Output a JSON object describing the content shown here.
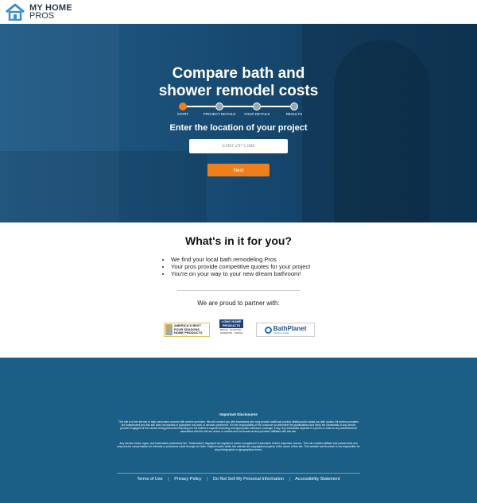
{
  "brand": {
    "line1": "MY HOME",
    "line2": "PROS",
    "accent": "#f07e1a",
    "footer_color": "#1b5f86"
  },
  "hero": {
    "title_line1": "Compare bath and",
    "title_line2": "shower remodel costs",
    "steps": [
      "START",
      "PROJECT DETAILS",
      "YOUR DETAILS",
      "RESULTS"
    ],
    "active_step_index": 0,
    "subtitle": "Enter the location of your project",
    "zip_placeholder": "Enter ZIP Code",
    "next_label": "Next"
  },
  "benefits": {
    "heading": "What's in it for you?",
    "items": [
      "We find your local bath remodeling Pros",
      "Your pros provide competitive quotes for your project",
      "You're on your way to your new dream bathroom!"
    ],
    "partner_heading": "We are proud to partner with:",
    "partners": [
      {
        "name": "FOUR SEASONS HOME PRODUCTS",
        "prefix": "AMERICA'S BEST"
      },
      {
        "name": "LONG HOME PRODUCTS",
        "tag": "BATHS · ROOFING · WINDOWS · SIDING"
      },
      {
        "name": "BathPlanet",
        "tag": "A Division of Valor"
      }
    ]
  },
  "footer": {
    "disclosures_title": "Important Disclosures",
    "disclosure_1": "This site is a free service to help consumers connect with service providers. We will connect you with businesses who may provide additional product details and/or assist you with quotes. All service providers are independent and this site does not warrant or guarantee any work or services performed. It is the responsibility of the consumer to determine the qualifications and verify the credentials of any service provider engaged for the service being performed including but not limited to required licensing and appropriate insurance coverage, if any. Any individuals depicted in a photo or video in any advertisement associated with this site are actors or models and not actual service providers affiliated with this site.",
    "disclosure_2": "Any service marks, logos, and trademarks (collectively the \"Trademarks\") displayed are registered and/or unregistered Trademarks of their respective owners. This site contains affiliate and partner links and may receive compensation for referrals or purchases made through our links. Subject matter within this website are copyrighted property of the owner of this site. This website and its owner is not responsible for any photographic or typographical errors.",
    "links": [
      "Terms of Use",
      "Privacy Policy",
      "Do Not Sell My Personal Information",
      "Accessibility Statement"
    ]
  }
}
